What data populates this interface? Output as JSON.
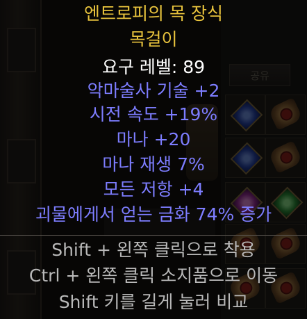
{
  "background": {
    "stash_tab_label": "공유"
  },
  "item": {
    "name": "엔트로피의 목 장식",
    "type": "목걸이",
    "requirement": "요구 레벨: 89",
    "properties": [
      "악마술사 기술 +2",
      "시전 속도 +19%",
      "마나 +20",
      "마나 재생 7%",
      "모든 저항 +4",
      "괴물에게서 얻는 금화 74% 증가"
    ]
  },
  "hints": [
    "Shift + 왼쪽 클릭으로 착용",
    "Ctrl + 왼쪽 클릭 소지품으로 이동",
    "Shift 키를 길게 눌러 비교"
  ],
  "colors": {
    "unique_name": "#e8c33d",
    "requirement": "#ffffff",
    "magic_property": "#7d7dff",
    "hint": "#b9b9b9"
  }
}
